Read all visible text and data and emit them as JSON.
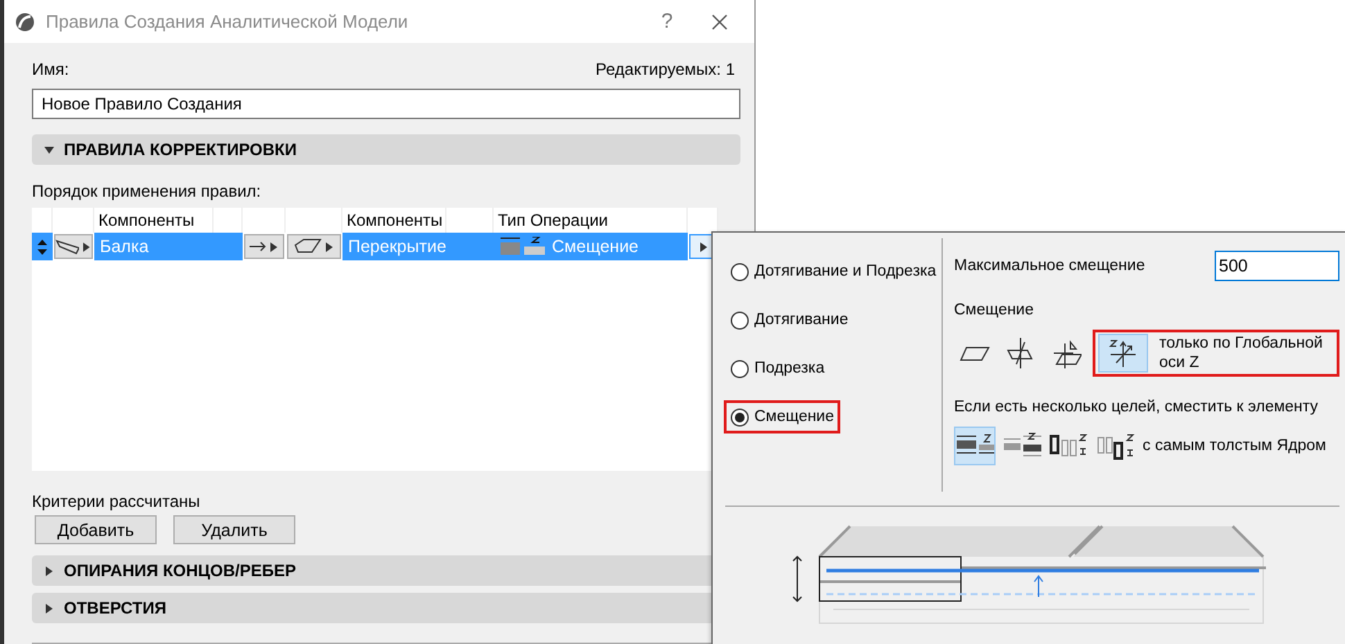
{
  "window": {
    "title": "Правила Создания Аналитической Модели",
    "help": "?"
  },
  "name": {
    "label": "Имя:",
    "edit_count": "Редактируемых: 1",
    "value": "Новое Правило Создания"
  },
  "correction_section": {
    "title": "ПРАВИЛА КОРРЕКТИРОВКИ",
    "expanded": true,
    "order_label": "Порядок применения правил:",
    "table": {
      "columns": [
        "Компоненты",
        "Компоненты",
        "Тип Операции"
      ],
      "rows": [
        {
          "source": "Балка",
          "target": "Перекрытие",
          "operation": "Смещение",
          "selected": true
        }
      ]
    },
    "status": "Критерии рассчитаны",
    "buttons": [
      "Добавить",
      "Удалить"
    ]
  },
  "collapsed_sections": [
    {
      "title": "ОПИРАНИЯ КОНЦОВ/РЕБЕР",
      "expanded": false
    },
    {
      "title": "ОТВЕРСТИЯ",
      "expanded": false
    }
  ],
  "popup": {
    "options": [
      {
        "label": "Дотягивание и Подрезка",
        "selected": false,
        "highlighted": false
      },
      {
        "label": "Дотягивание",
        "selected": false,
        "highlighted": false
      },
      {
        "label": "Подрезка",
        "selected": false,
        "highlighted": false
      },
      {
        "label": "Смещение",
        "selected": true,
        "highlighted": true
      }
    ],
    "max_offset": {
      "label": "Максимальное смещение",
      "value": "500"
    },
    "offset": {
      "label": "Смещение",
      "highlighted": true,
      "text": "только по Глобальной оси Z",
      "modes": [
        {
          "kind": "plane",
          "selected": false
        },
        {
          "kind": "crossing",
          "selected": false
        },
        {
          "kind": "angle",
          "selected": false
        },
        {
          "kind": "global-z",
          "selected": true
        }
      ]
    },
    "target": {
      "label": "Если есть несколько целей, сместить к элементу",
      "text": "с самым толстым Ядром",
      "modes": [
        {
          "kind": "core-top",
          "selected": true
        },
        {
          "kind": "core-bottom",
          "selected": false
        },
        {
          "kind": "thick-left",
          "selected": false
        },
        {
          "kind": "thick-right",
          "selected": false
        }
      ]
    }
  }
}
